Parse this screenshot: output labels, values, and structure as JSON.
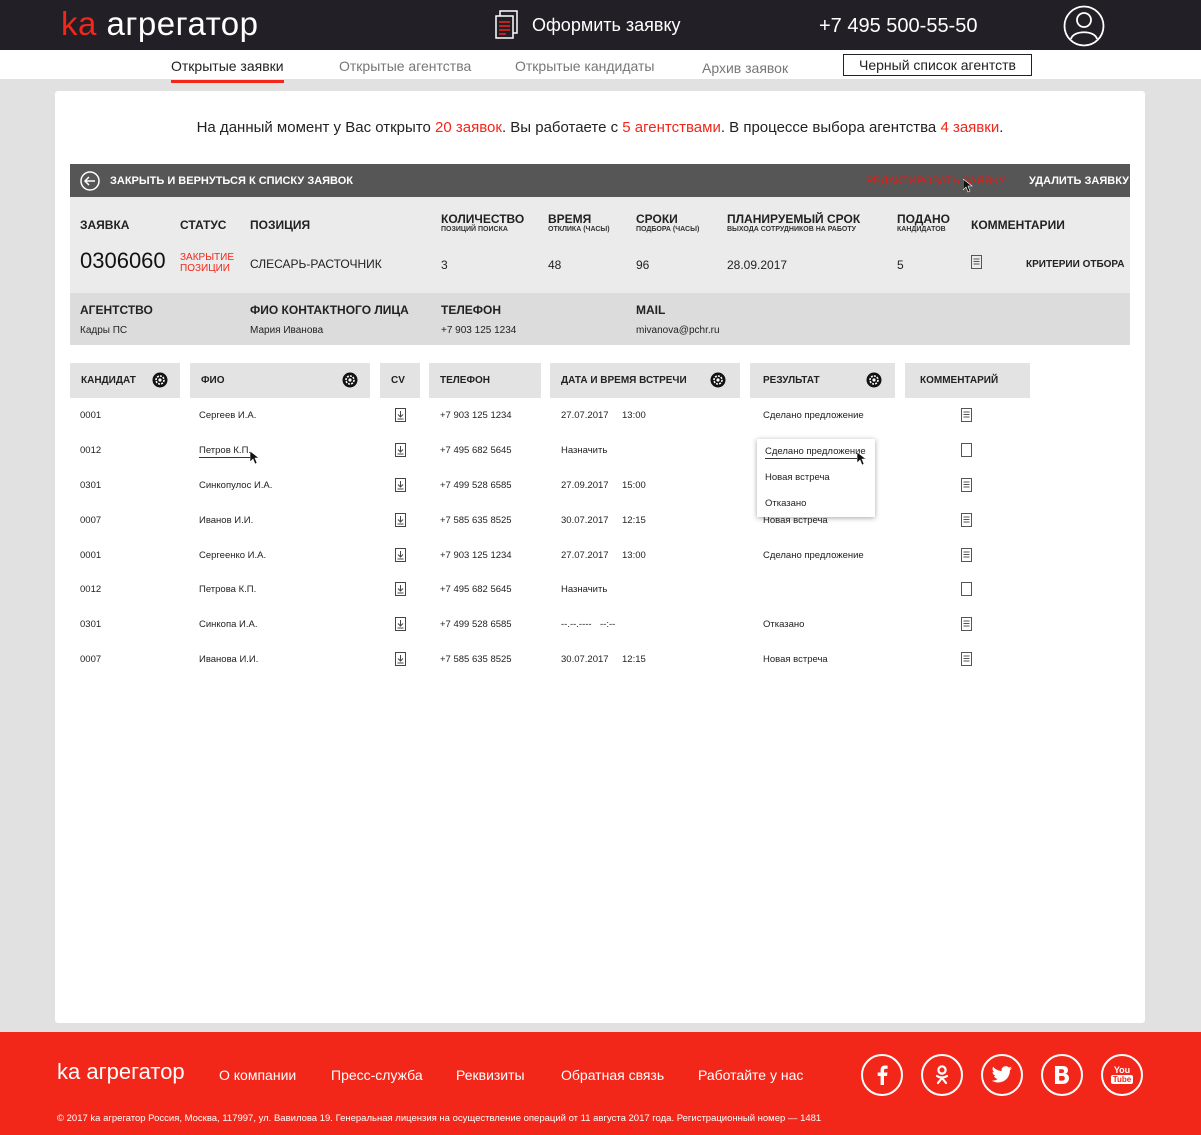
{
  "header": {
    "logo_prefix": "ka",
    "logo_text": "агрегатор",
    "order_button": "Оформить заявку",
    "phone": "+7 495 500-55-50"
  },
  "nav": {
    "items": [
      "Открытые заявки",
      "Открытые агентства",
      "Открытые кандидаты",
      "Архив заявок"
    ],
    "active_index": 0,
    "blacklist_button": "Черный список агентств"
  },
  "summary": {
    "part1": "На данный момент у Вас открыто ",
    "requests": "20 заявок",
    "part2": ". Вы работаете с ",
    "agencies": "5 агентствами",
    "part3": ". В процессе выбора агентства ",
    "selecting": "4 заявки",
    "part4": "."
  },
  "toolbar": {
    "back_label": "ЗАКРЫТЬ И ВЕРНУТЬСЯ К СПИСКУ ЗАЯВОК",
    "edit_label": "РЕДАКТИРОВАТЬ ЗАЯВКУ",
    "delete_label": "УДАЛИТЬ ЗАЯВКУ"
  },
  "request": {
    "headers": {
      "number": "ЗАЯВКА",
      "status": "СТАТУС",
      "position": "ПОЗИЦИЯ",
      "quantity": "КОЛИЧЕСТВО",
      "quantity_sub": "ПОЗИЦИЙ ПОИСКА",
      "time": "ВРЕМЯ",
      "time_sub": "ОТКЛИКА (ЧАСЫ)",
      "terms": "СРОКИ",
      "terms_sub": "ПОДБОРА (ЧАСЫ)",
      "planned": "ПЛАНИРУЕМЫЙ СРОК",
      "planned_sub": "ВЫХОДА СОТРУДНИКОВ НА РАБОТУ",
      "submitted": "ПОДАНО",
      "submitted_sub": "КАНДИДАТОВ",
      "comments": "КОММЕНТАРИИ"
    },
    "number": "0306060",
    "status_line1": "ЗАКРЫТИЕ",
    "status_line2": "ПОЗИЦИИ",
    "position": "СЛЕСАРЬ-РАСТОЧНИК",
    "quantity": "3",
    "time": "48",
    "terms": "96",
    "planned": "28.09.2017",
    "submitted": "5",
    "criteria": "КРИТЕРИИ ОТБОРА"
  },
  "agency": {
    "headers": {
      "agency": "АГЕНТСТВО",
      "contact": "ФИО КОНТАКТНОГО ЛИЦА",
      "phone": "ТЕЛЕФОН",
      "mail": "MAIL"
    },
    "agency": "Кадры ПС",
    "contact": "Мария Иванова",
    "phone": "+7 903 125 1234",
    "mail": "mivanova@pchr.ru"
  },
  "table": {
    "columns": [
      "КАНДИДАТ",
      "ФИО",
      "CV",
      "ТЕЛЕФОН",
      "ДАТА И ВРЕМЯ ВСТРЕЧИ",
      "РЕЗУЛЬТАТ",
      "КОММЕНТАРИЙ"
    ],
    "rows": [
      {
        "id": "0001",
        "name": "Сергеев И.А.",
        "phone": "+7 903 125 1234",
        "date": "27.07.2017",
        "time": "13:00",
        "result": "Сделано предложение",
        "has_comment": true
      },
      {
        "id": "0012",
        "name": "Петров К.П.",
        "phone": "+7 495 682 5645",
        "date": "Назначить",
        "time": "",
        "result": "",
        "has_comment": false
      },
      {
        "id": "0301",
        "name": "Синкопулос И.А.",
        "phone": "+7 499 528 6585",
        "date": "27.09.2017",
        "time": "15:00",
        "result": "",
        "has_comment": true
      },
      {
        "id": "0007",
        "name": "Иванов И.И.",
        "phone": "+7 585 635 8525",
        "date": "30.07.2017",
        "time": "12:15",
        "result": "Новая встреча",
        "has_comment": true
      },
      {
        "id": "0001",
        "name": "Сергеенко И.А.",
        "phone": "+7 903 125 1234",
        "date": "27.07.2017",
        "time": "13:00",
        "result": "Сделано предложение",
        "has_comment": true
      },
      {
        "id": "0012",
        "name": "Петрова К.П.",
        "phone": "+7 495 682 5645",
        "date": "Назначить",
        "time": "",
        "result": "",
        "has_comment": false
      },
      {
        "id": "0301",
        "name": "Синкопа И.А.",
        "phone": "+7 499 528 6585",
        "date": "--.--.----",
        "time": "--:--",
        "result": "Отказано",
        "has_comment": true
      },
      {
        "id": "0007",
        "name": "Иванова И.И.",
        "phone": "+7 585 635 8525",
        "date": "30.07.2017",
        "time": "12:15",
        "result": "Новая встреча",
        "has_comment": true
      }
    ],
    "result_dropdown": [
      "Сделано предложение",
      "Новая встреча",
      "Отказано"
    ]
  },
  "footer": {
    "logo": "ka агрегатор",
    "links": [
      "О компании",
      "Пресс-служба",
      "Реквизиты",
      "Обратная связь",
      "Работайте у нас"
    ],
    "social": [
      "facebook-icon",
      "odnoklassniki-icon",
      "twitter-icon",
      "vkontakte-icon",
      "youtube-icon"
    ],
    "social_youtube_line1": "You",
    "social_youtube_line2": "Tube",
    "copyright": "© 2017 ka агрегатор   Россия, Москва, 117997, ул. Вавилова 19.  Генеральная лицензия на осуществление операций от 11 августа 2017 года. Регистрационный номер — 1481"
  },
  "colors": {
    "accent": "#f2271a",
    "header_bg": "#231f26",
    "bar_dark": "#565656",
    "page_bg": "#e1e1e2"
  }
}
